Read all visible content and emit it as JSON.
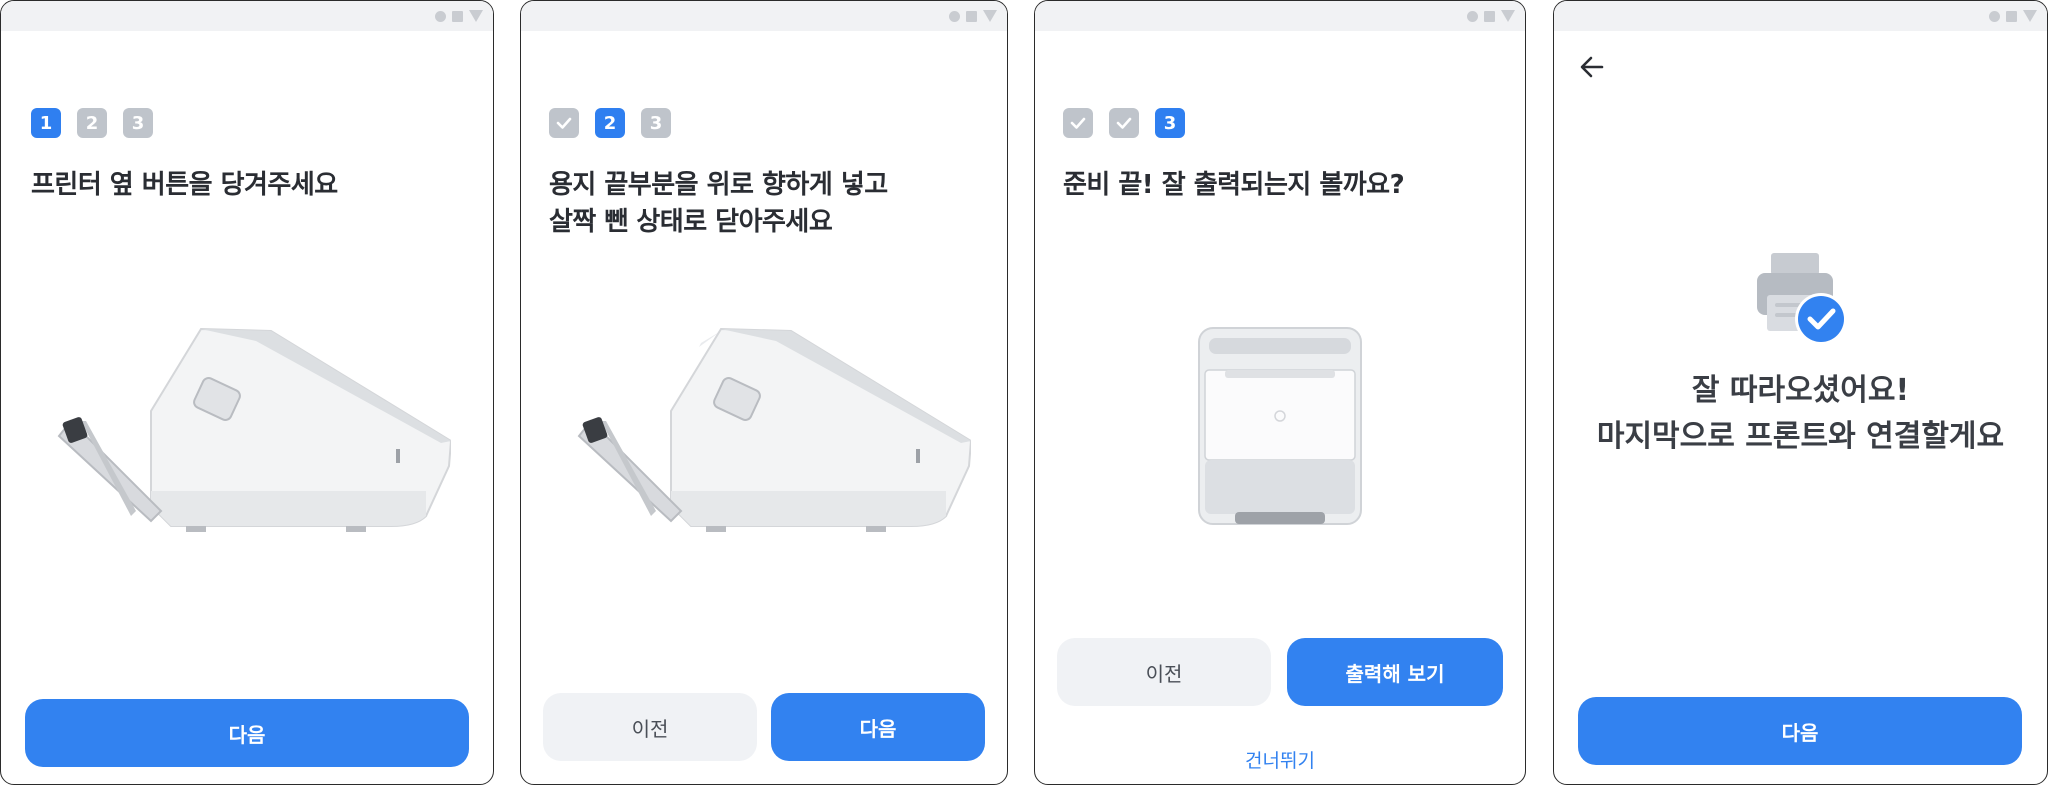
{
  "screen1": {
    "steps": [
      "1",
      "2",
      "3"
    ],
    "title_lines": [
      "프린터 옆 버튼을 당겨주세요"
    ],
    "next_label": "다음",
    "illustration_icon": "printer-side-open-illustration"
  },
  "screen2": {
    "steps": [
      "",
      "2",
      "3"
    ],
    "title_lines": [
      "용지 끝부분을 위로 향하게 넣고",
      "살짝 뺀 상태로 닫아주세요"
    ],
    "prev_label": "이전",
    "next_label": "다음",
    "illustration_icon": "printer-side-paper-illustration"
  },
  "screen3": {
    "steps": [
      "",
      "",
      "3"
    ],
    "title_lines": [
      "준비 끝! 잘 출력되는지 볼까요?"
    ],
    "prev_label": "이전",
    "print_label": "출력해 보기",
    "skip_label": "건너뛰기",
    "illustration_icon": "printer-front-illustration"
  },
  "screen4": {
    "back_icon": "arrow-left-icon",
    "message_lines": [
      "잘 따라오셨어요!",
      "마지막으로 프론트와 연결할게요"
    ],
    "next_label": "다음",
    "icon": "printer-check-icon"
  },
  "colors": {
    "primary": "#3282f0",
    "step_inactive": "#bfc4cb",
    "secondary_button": "#f0f2f5",
    "text": "#2a2d33"
  }
}
